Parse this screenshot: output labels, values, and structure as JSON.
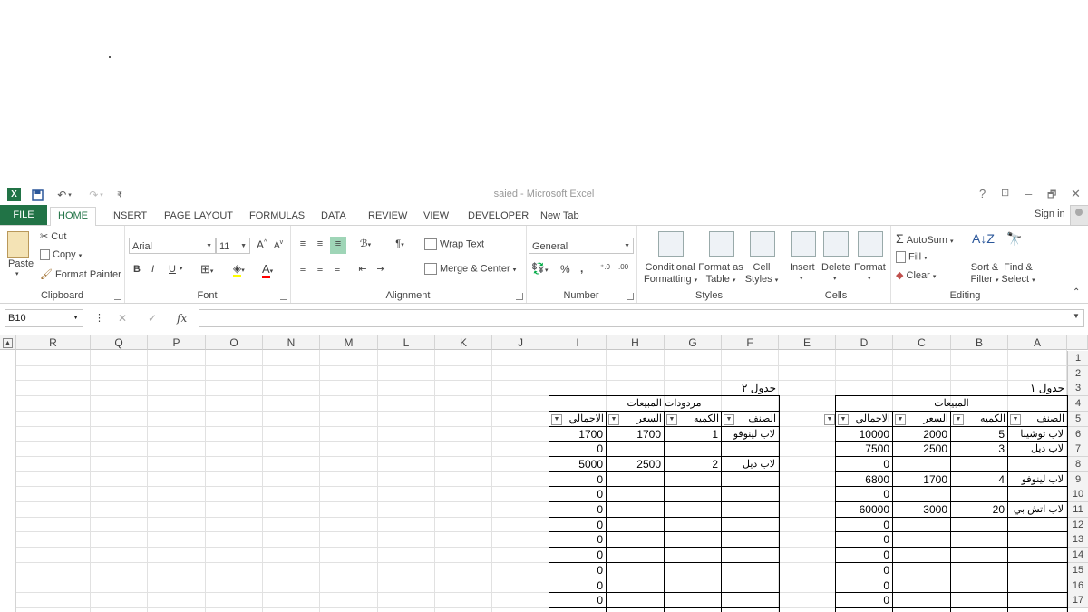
{
  "window": {
    "title": "saied - Microsoft Excel",
    "help": "?",
    "restore_ribbon": "⊡",
    "minimize": "–",
    "maximize": "🗗",
    "close": "✕"
  },
  "tabs": [
    "FILE",
    "HOME",
    "INSERT",
    "PAGE LAYOUT",
    "FORMULAS",
    "DATA",
    "REVIEW",
    "VIEW",
    "DEVELOPER",
    "New Tab"
  ],
  "signin": "Sign in",
  "clipboard": {
    "paste": "Paste",
    "cut": "Cut",
    "copy": "Copy",
    "format_painter": "Format Painter",
    "label": "Clipboard"
  },
  "font": {
    "name": "Arial",
    "size": "11",
    "bold": "B",
    "italic": "I",
    "underline": "U",
    "label": "Font"
  },
  "alignment": {
    "wrap": "Wrap Text",
    "merge": "Merge & Center",
    "label": "Alignment"
  },
  "number": {
    "format": "General",
    "percent": "%",
    "comma": ",",
    "label": "Number"
  },
  "styles": {
    "cond": "Conditional",
    "cond2": "Formatting",
    "fmt_table": "Format as",
    "fmt_table2": "Table",
    "cell_styles": "Cell",
    "cell_styles2": "Styles",
    "label": "Styles"
  },
  "cells": {
    "insert": "Insert",
    "delete": "Delete",
    "format": "Format",
    "label": "Cells"
  },
  "editing": {
    "autosum": "AutoSum",
    "fill": "Fill",
    "clear": "Clear",
    "sort": "Sort &",
    "sort2": "Filter",
    "find": "Find &",
    "find2": "Select",
    "label": "Editing"
  },
  "formula_bar": {
    "name_box": "B10",
    "fx": "fx",
    "cancel": "✕",
    "enter": "✓"
  },
  "columns": [
    "R",
    "Q",
    "P",
    "O",
    "N",
    "M",
    "L",
    "K",
    "J",
    "I",
    "H",
    "G",
    "F",
    "E",
    "D",
    "C",
    "B",
    "A"
  ],
  "rows": [
    "1",
    "2",
    "3",
    "4",
    "5",
    "6",
    "7",
    "8",
    "9",
    "10",
    "11",
    "12",
    "13",
    "14",
    "15",
    "16",
    "17"
  ],
  "table1": {
    "caption": "جدول ١",
    "title": "المبيعات",
    "headers": [
      "الصنف",
      "الكميه",
      "السعر",
      "الاجمالي"
    ],
    "rows": [
      [
        "لاب توشيبا",
        "5",
        "2000",
        "10000"
      ],
      [
        "لاب ديل",
        "3",
        "2500",
        "7500"
      ],
      [
        "",
        "",
        "",
        "0"
      ],
      [
        "لاب لينوفو",
        "4",
        "1700",
        "6800"
      ],
      [
        "",
        "",
        "",
        "0"
      ],
      [
        "لاب اتش بي",
        "20",
        "3000",
        "60000"
      ],
      [
        "",
        "",
        "",
        "0"
      ],
      [
        "",
        "",
        "",
        "0"
      ],
      [
        "",
        "",
        "",
        "0"
      ],
      [
        "",
        "",
        "",
        "0"
      ],
      [
        "",
        "",
        "",
        "0"
      ],
      [
        "",
        "",
        "",
        "0"
      ]
    ]
  },
  "table2": {
    "caption": "جدول ٢",
    "title": "مردودات المبيعات",
    "headers": [
      "الصنف",
      "الكميه",
      "السعر",
      "الاجمالي"
    ],
    "rows": [
      [
        "لاب لينوفو",
        "1",
        "1700",
        "1700"
      ],
      [
        "",
        "",
        "",
        "0"
      ],
      [
        "لاب ديل",
        "2",
        "2500",
        "5000"
      ],
      [
        "",
        "",
        "",
        "0"
      ],
      [
        "",
        "",
        "",
        "0"
      ],
      [
        "",
        "",
        "",
        "0"
      ],
      [
        "",
        "",
        "",
        "0"
      ],
      [
        "",
        "",
        "",
        "0"
      ],
      [
        "",
        "",
        "",
        "0"
      ],
      [
        "",
        "",
        "",
        "0"
      ],
      [
        "",
        "",
        "",
        "0"
      ],
      [
        "",
        "",
        "",
        "0"
      ]
    ]
  }
}
